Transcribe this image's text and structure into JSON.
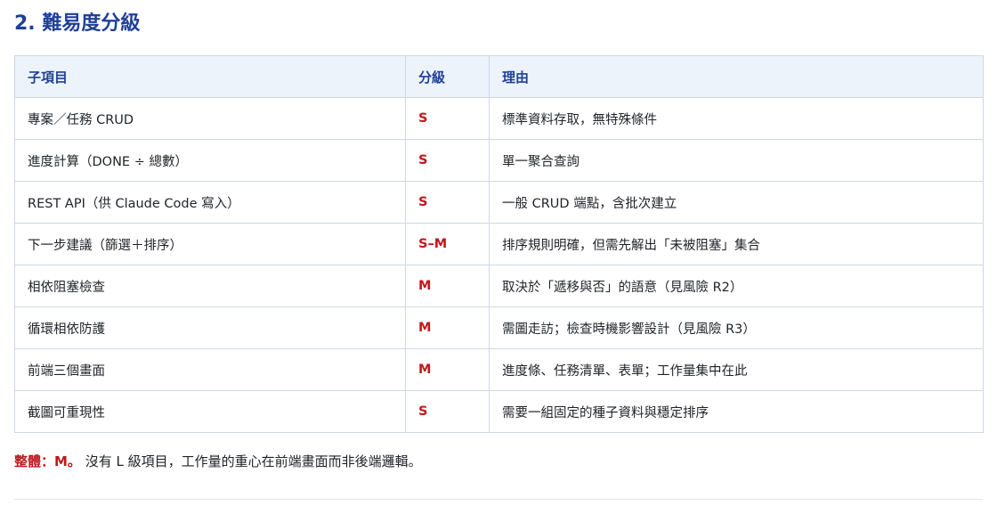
{
  "section": {
    "title": "2. 難易度分級",
    "table": {
      "headers": [
        "子項目",
        "分級",
        "理由"
      ],
      "rows": [
        {
          "item": "專案／任務 CRUD",
          "grade": "S",
          "reason": "標準資料存取，無特殊條件"
        },
        {
          "item": "進度計算（DONE ÷ 總數）",
          "grade": "S",
          "reason": "單一聚合查詢"
        },
        {
          "item": "REST API（供 Claude Code 寫入）",
          "grade": "S",
          "reason": "一般 CRUD 端點，含批次建立"
        },
        {
          "item": "下一步建議（篩選＋排序）",
          "grade": "S–M",
          "reason": "排序規則明確，但需先解出「未被阻塞」集合"
        },
        {
          "item": "相依阻塞檢查",
          "grade": "M",
          "reason": "取決於「遞移與否」的語意（見風險 R2）"
        },
        {
          "item": "循環相依防護",
          "grade": "M",
          "reason": "需圖走訪；檢查時機影響設計（見風險 R3）"
        },
        {
          "item": "前端三個畫面",
          "grade": "M",
          "reason": "進度條、任務清單、表單；工作量集中在此"
        },
        {
          "item": "截圖可重現性",
          "grade": "S",
          "reason": "需要一組固定的種子資料與穩定排序"
        }
      ]
    },
    "summary": {
      "lead": "整體：M。",
      "text": " 沒有 L 級項目，工作量的重心在前端畫面而非後端邏輯。"
    }
  },
  "colors": {
    "heading": "#1f3f99",
    "grade": "#c0171e",
    "header_bg": "#edf3fb",
    "border": "#cfd7e6"
  }
}
